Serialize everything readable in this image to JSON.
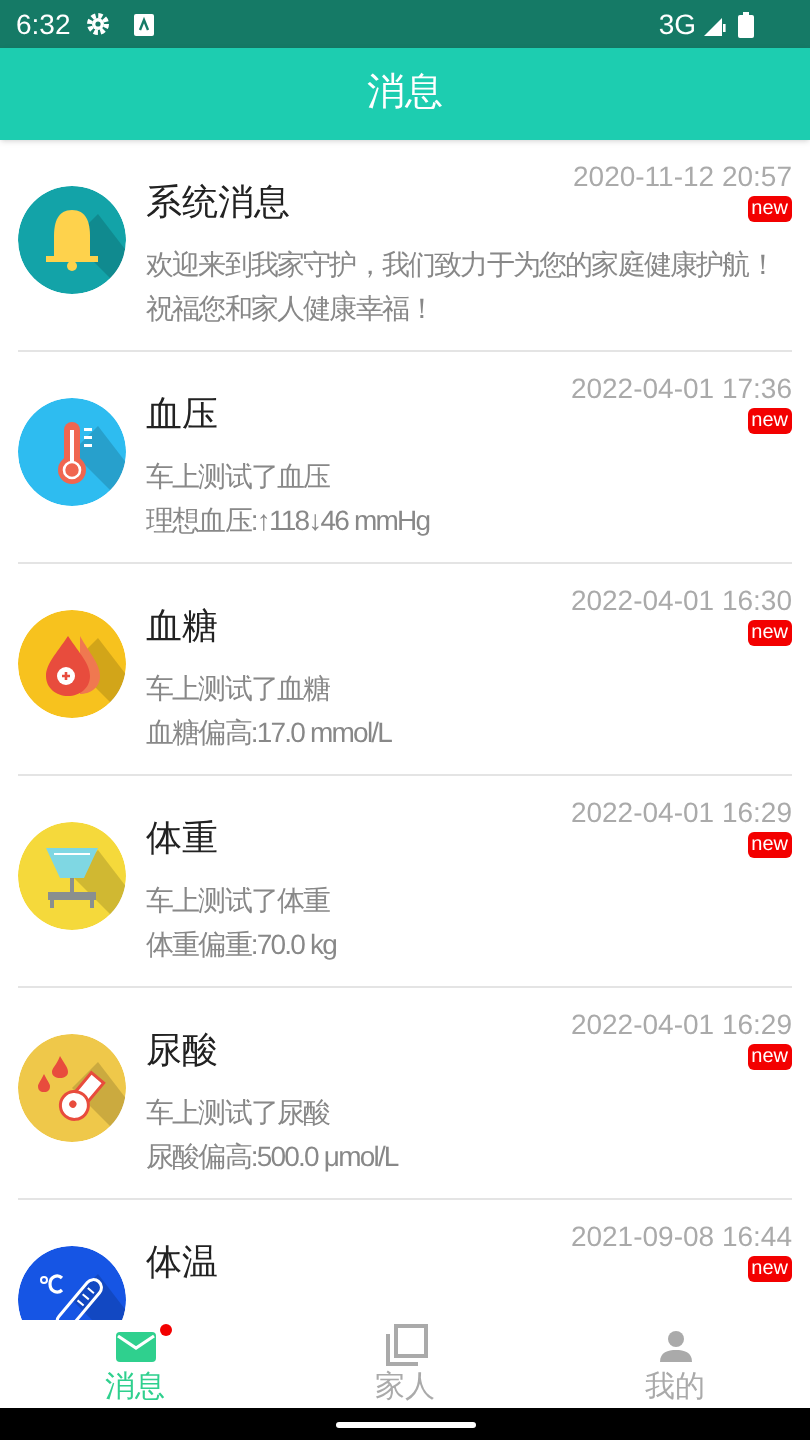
{
  "status_bar": {
    "time": "6:32",
    "network": "3G"
  },
  "header": {
    "title": "消息"
  },
  "messages": [
    {
      "kind": "bell",
      "title": "系统消息",
      "time": "2020-11-12 20:57",
      "new_label": "new",
      "lines": [
        "欢迎来到我家守护，我们致力于为您的家庭健康护航！祝福您和家人健康幸福！"
      ]
    },
    {
      "kind": "thermometer",
      "title": "血压",
      "time": "2022-04-01 17:36",
      "new_label": "new",
      "lines": [
        "车上测试了血压",
        "理想血压:↑118↓46 mmHg"
      ]
    },
    {
      "kind": "drop",
      "title": "血糖",
      "time": "2022-04-01 16:30",
      "new_label": "new",
      "lines": [
        "车上测试了血糖",
        "血糖偏高:17.0 mmol/L"
      ]
    },
    {
      "kind": "scale",
      "title": "体重",
      "time": "2022-04-01 16:29",
      "new_label": "new",
      "lines": [
        "车上测试了体重",
        "体重偏重:70.0 kg"
      ]
    },
    {
      "kind": "flask",
      "title": "尿酸",
      "time": "2022-04-01 16:29",
      "new_label": "new",
      "lines": [
        "车上测试了尿酸",
        "尿酸偏高:500.0 μmol/L"
      ]
    },
    {
      "kind": "temperature",
      "title": "体温",
      "time": "2021-09-08 16:44",
      "new_label": "new"
    }
  ],
  "tabs": [
    {
      "label": "消息",
      "kind": "mail",
      "selected": true,
      "unread_dot": true
    },
    {
      "label": "家人",
      "kind": "copy",
      "selected": false,
      "unread_dot": false
    },
    {
      "label": "我的",
      "kind": "person",
      "selected": false,
      "unread_dot": false
    }
  ]
}
